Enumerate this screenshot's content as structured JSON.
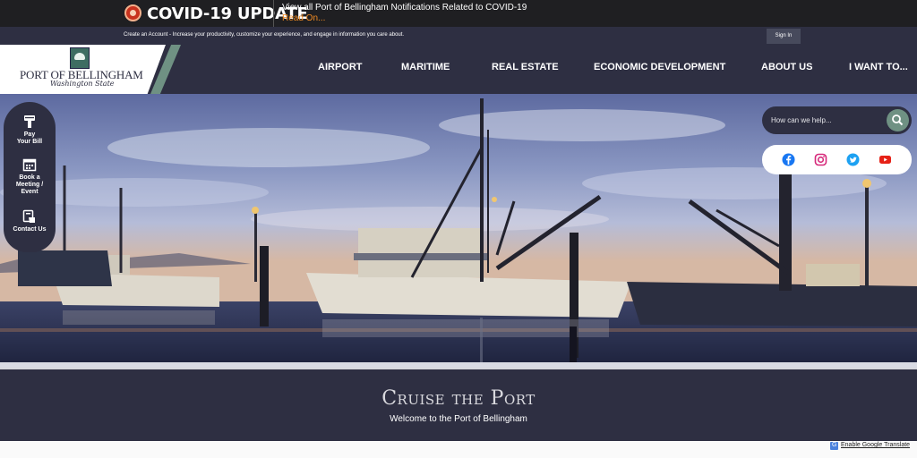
{
  "alert": {
    "title": "COVID-19 UPDATE",
    "message": "View all Port of Bellingham Notifications Related to COVID-19",
    "link": "Read On..."
  },
  "account_bar": {
    "create_account": "Create an Account",
    "description": " - Increase your productivity, customize your experience, and engage in information you care about.",
    "sign_in": "Sign In"
  },
  "logo": {
    "name": "PORT OF BELLINGHAM",
    "tagline": "Washington State"
  },
  "nav": {
    "items": [
      {
        "label": "AIRPORT"
      },
      {
        "label": "MARITIME"
      },
      {
        "label": "REAL ESTATE"
      },
      {
        "label": "ECONOMIC DEVELOPMENT"
      },
      {
        "label": "ABOUT US"
      },
      {
        "label": "I WANT TO..."
      }
    ]
  },
  "quick_links": [
    {
      "label_line1": "Pay",
      "label_line2": "Your Bill",
      "icon": "pay-bill-icon"
    },
    {
      "label_line1": "Book a",
      "label_line2": "Meeting /",
      "label_line3": "Event",
      "icon": "calendar-icon"
    },
    {
      "label_line1": "Contact Us",
      "icon": "contact-icon"
    }
  ],
  "search": {
    "placeholder": "How can we help...",
    "icon": "search-icon"
  },
  "social": [
    {
      "name": "facebook-icon",
      "color": "#1877f2"
    },
    {
      "name": "instagram-icon",
      "color": "#d6297a"
    },
    {
      "name": "twitter-icon",
      "color": "#1da1f2"
    },
    {
      "name": "youtube-icon",
      "color": "#e62117"
    }
  ],
  "banner": {
    "title": "Cruise the Port",
    "subtitle": "Welcome to the Port of Bellingham"
  },
  "footer": {
    "translate": "Enable Google Translate"
  },
  "colors": {
    "navy": "#2e2f42",
    "accent_green": "#6f9183",
    "alert_link": "#f28b22"
  }
}
